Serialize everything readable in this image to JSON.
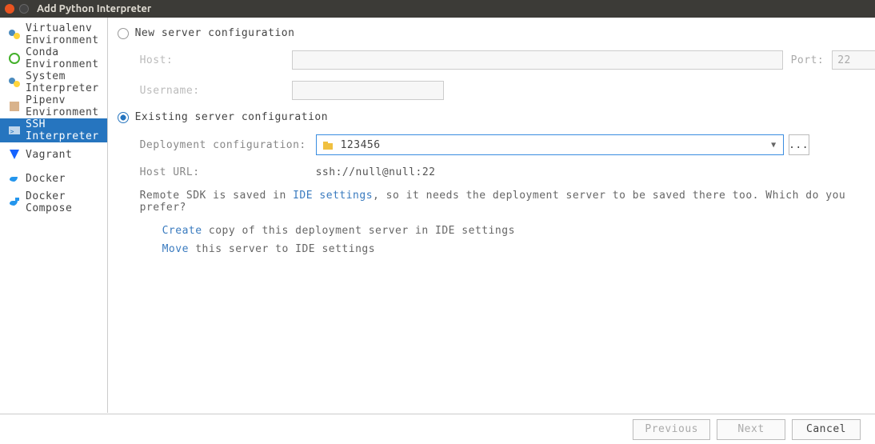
{
  "titlebar": {
    "title": "Add Python Interpreter"
  },
  "sidebar": {
    "items": [
      {
        "label": "Virtualenv Environment",
        "icon": "python-icon"
      },
      {
        "label": "Conda Environment",
        "icon": "conda-icon"
      },
      {
        "label": "System Interpreter",
        "icon": "python-icon"
      },
      {
        "label": "Pipenv Environment",
        "icon": "pipenv-icon"
      },
      {
        "label": "SSH Interpreter",
        "icon": "ssh-icon",
        "selected": true
      },
      {
        "label": "Vagrant",
        "icon": "vagrant-icon"
      },
      {
        "label": "Docker",
        "icon": "docker-icon"
      },
      {
        "label": "Docker Compose",
        "icon": "docker-compose-icon"
      }
    ]
  },
  "main": {
    "new_config": {
      "label": "New server configuration",
      "host_label": "Host:",
      "host_value": "",
      "port_label": "Port:",
      "port_value": "22",
      "user_label": "Username:",
      "user_value": ""
    },
    "existing_config": {
      "label": "Existing server configuration",
      "selected": true,
      "deploy_label": "Deployment configuration:",
      "deploy_value": "123456",
      "hosturl_label": "Host URL:",
      "hosturl_value": "ssh://null@null:22",
      "info_pre": "Remote SDK is saved in ",
      "info_link": "IDE settings",
      "info_post": ", so it needs the deployment server to be saved there too. Which do you prefer?",
      "create_action": "Create",
      "create_rest": " copy of this deployment server in IDE settings",
      "move_action": "Move",
      "move_rest": " this server to IDE settings",
      "more_label": "..."
    }
  },
  "footer": {
    "previous": "Previous",
    "next": "Next",
    "cancel": "Cancel"
  }
}
